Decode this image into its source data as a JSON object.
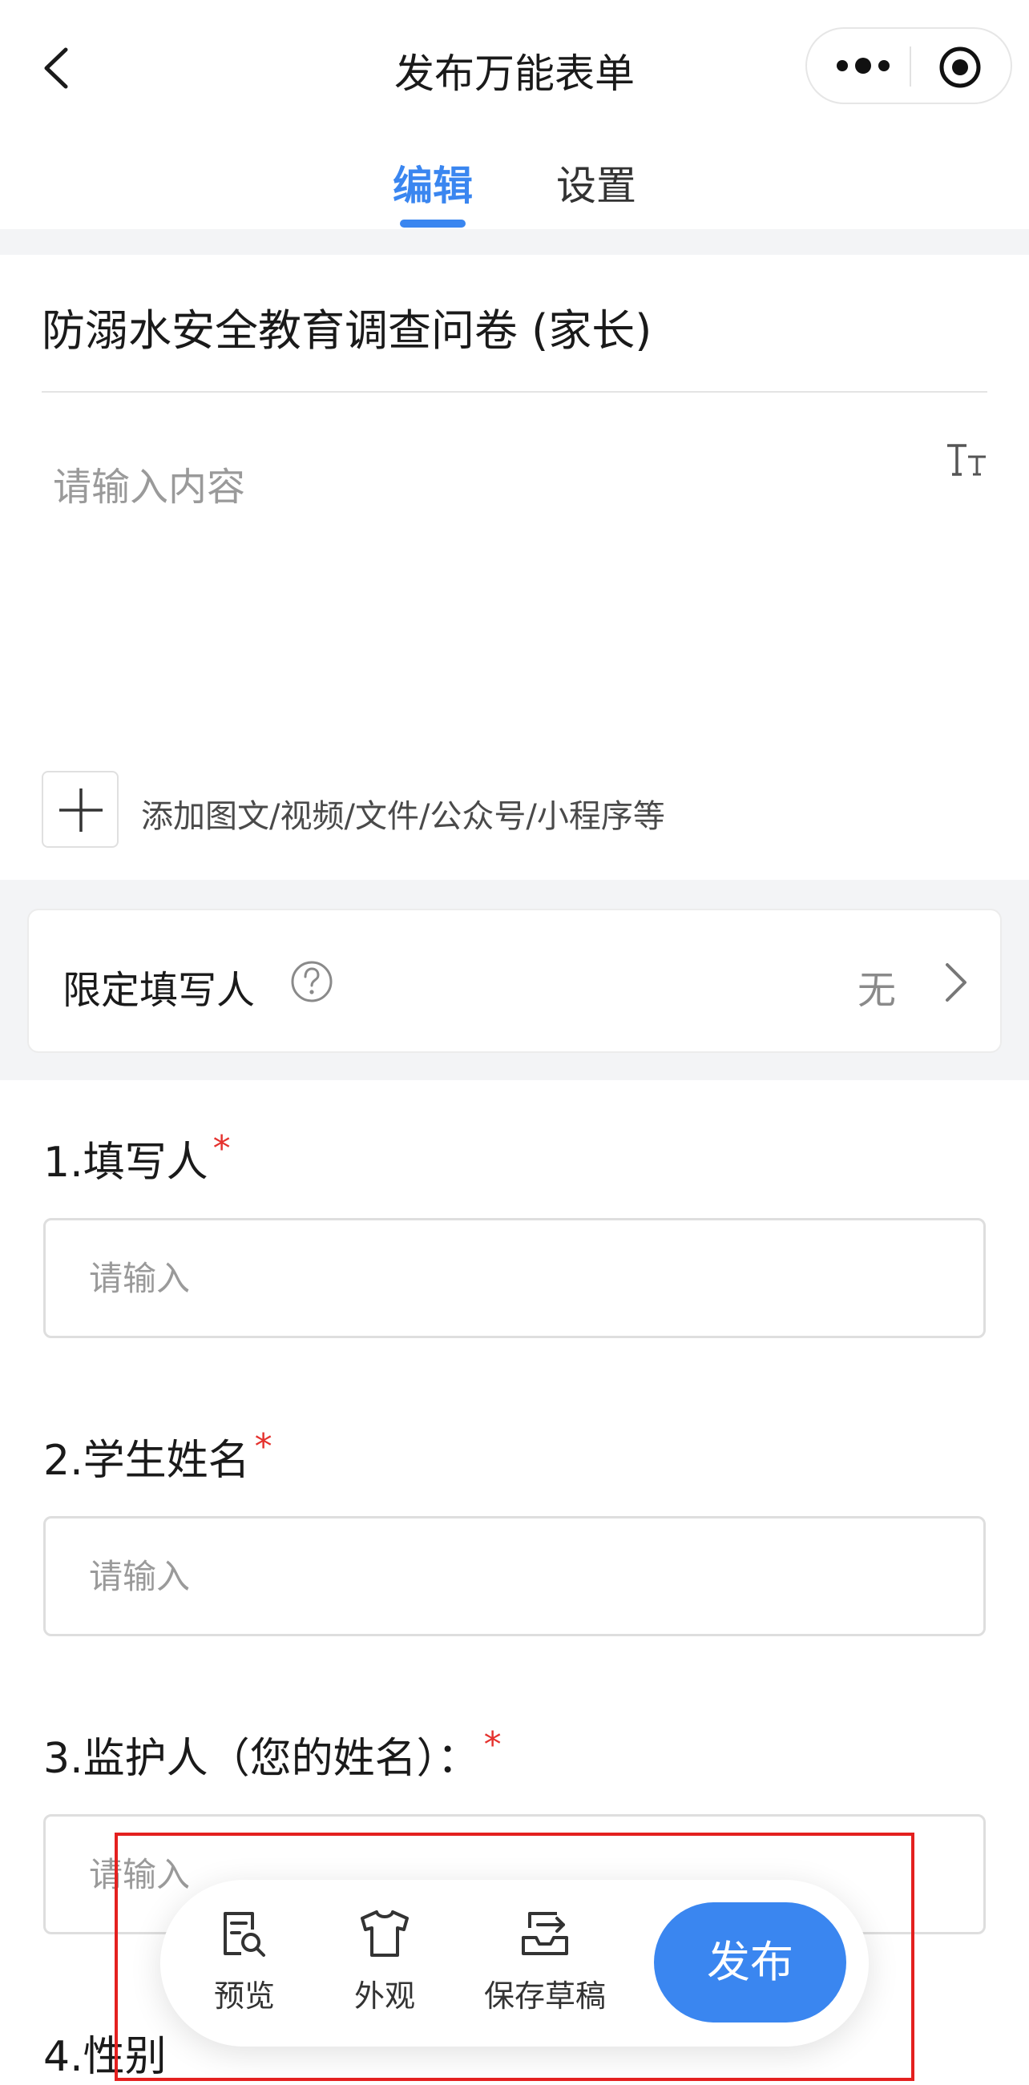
{
  "header": {
    "title": "发布万能表单"
  },
  "tabs": [
    {
      "label": "编辑",
      "active": true
    },
    {
      "label": "设置",
      "active": false
    }
  ],
  "form": {
    "title": "防溺水安全教育调查问卷 (家长)",
    "description_placeholder": "请输入内容",
    "add_media_label": "添加图文/视频/文件/公众号/小程序等"
  },
  "restrict": {
    "label": "限定填写人",
    "value": "无"
  },
  "questions": [
    {
      "label": "1.填写人",
      "required_mark": "*",
      "placeholder": "请输入"
    },
    {
      "label": "2.学生姓名",
      "required_mark": "*",
      "placeholder": "请输入"
    },
    {
      "label": "3.监护人（您的姓名）：",
      "required_mark": "*",
      "placeholder": "请输入"
    },
    {
      "label": "4.性别"
    }
  ],
  "toolbar": {
    "preview": "预览",
    "appearance": "外观",
    "save_draft": "保存草稿",
    "publish": "发布"
  },
  "colors": {
    "accent": "#3a86f0",
    "required": "#e5322e",
    "highlight_frame": "#e4201f"
  },
  "icons": {
    "back": "chevron-left-icon",
    "more": "more-dots-icon",
    "close_mini": "target-circle-icon",
    "text_size": "text-size-icon",
    "add": "plus-icon",
    "help": "question-circle-icon",
    "chevron": "chevron-right-icon",
    "preview": "document-search-icon",
    "appearance": "tshirt-icon",
    "save_draft": "tray-arrow-icon"
  }
}
